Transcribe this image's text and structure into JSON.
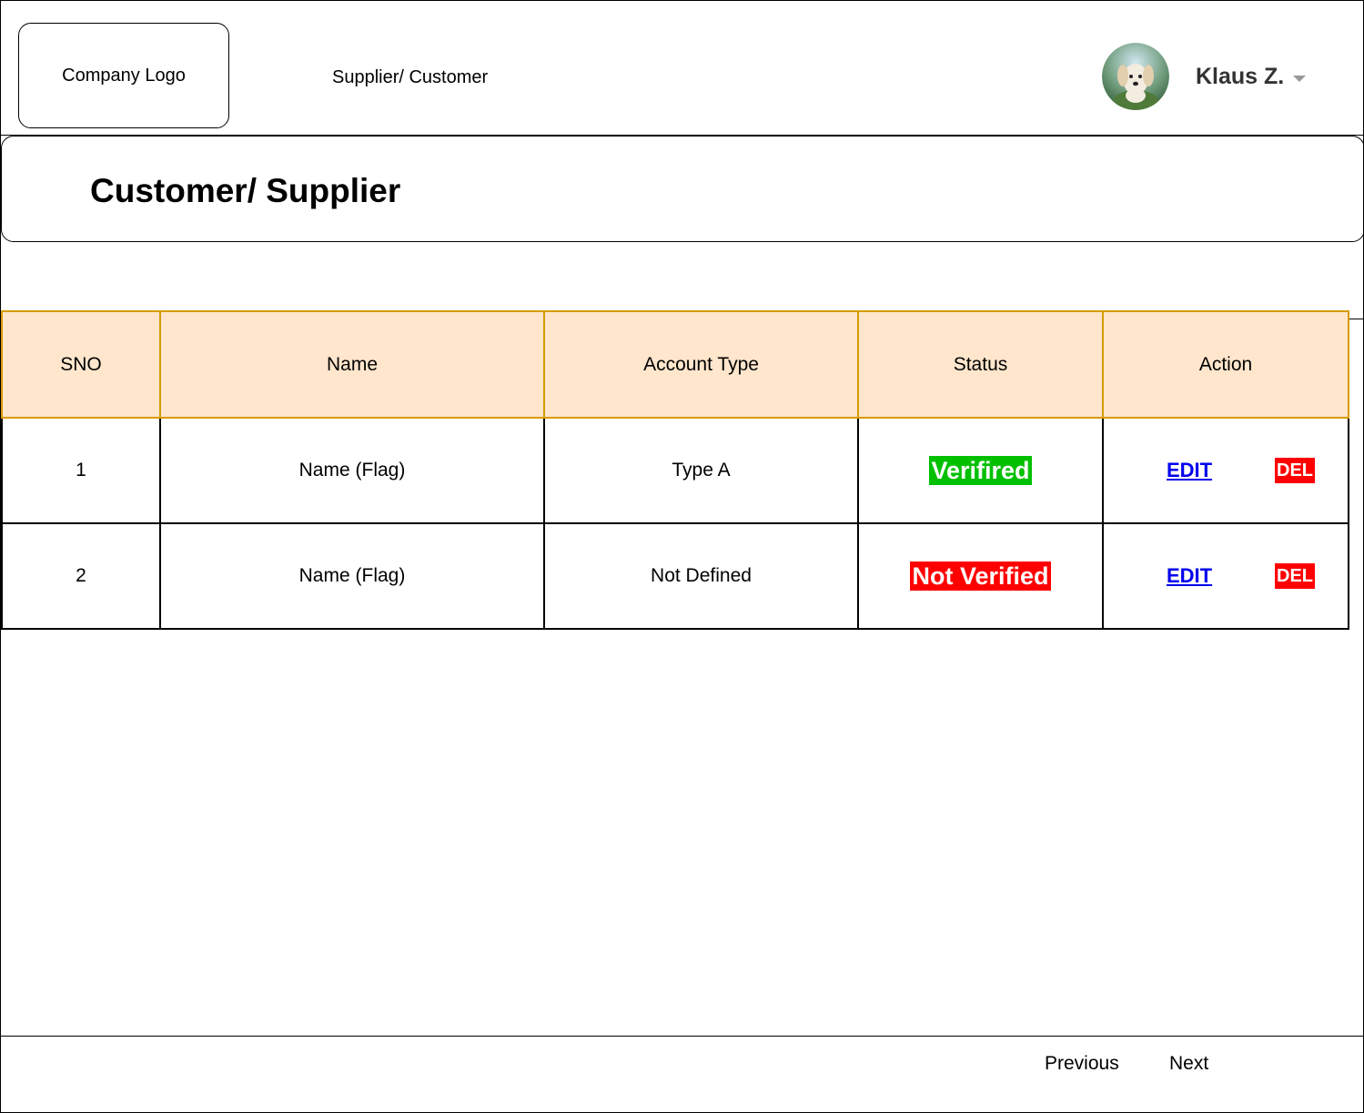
{
  "header": {
    "logo_label": "Company Logo",
    "nav_link": "Supplier/ Customer",
    "user": {
      "name": "Klaus Z.",
      "avatar_icon": "puppy-avatar"
    }
  },
  "page": {
    "title": "Customer/ Supplier"
  },
  "table": {
    "columns": [
      "SNO",
      "Name",
      "Account Type",
      "Status",
      "Action"
    ],
    "rows": [
      {
        "sno": "1",
        "name": "Name (Flag)",
        "account_type": "Type A",
        "status": "Verifired",
        "status_color": "#00c000",
        "edit_label": "EDIT",
        "delete_label": "DEL"
      },
      {
        "sno": "2",
        "name": "Name (Flag)",
        "account_type": "Not Defined",
        "status": "Not Verified",
        "status_color": "#ff0000",
        "edit_label": "EDIT",
        "delete_label": "DEL"
      }
    ]
  },
  "pagination": {
    "previous_label": "Previous",
    "next_label": "Next"
  },
  "colors": {
    "header_fill": "#ffe6cc",
    "header_border": "#d79b00",
    "link": "#0000ee",
    "delete": "#ff0000"
  }
}
